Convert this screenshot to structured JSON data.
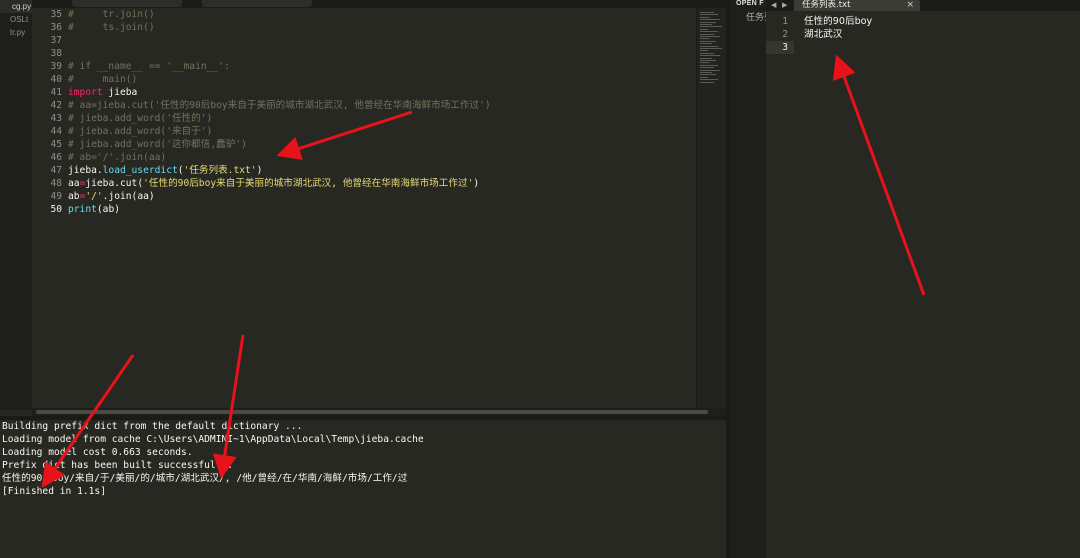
{
  "sidebar": {
    "items": [
      "cg.py",
      "OSLt",
      "tr.py"
    ]
  },
  "editor": {
    "active_line": 50,
    "lines": [
      {
        "n": 35,
        "segments": [
          {
            "t": "#     tr.join()",
            "c": "cm"
          }
        ]
      },
      {
        "n": 36,
        "segments": [
          {
            "t": "#     ts.join()",
            "c": "cm"
          }
        ]
      },
      {
        "n": 37,
        "segments": []
      },
      {
        "n": 38,
        "segments": []
      },
      {
        "n": 39,
        "segments": [
          {
            "t": "# if __name__ == '__main__':",
            "c": "cm"
          }
        ]
      },
      {
        "n": 40,
        "segments": [
          {
            "t": "#     main()",
            "c": "cm"
          }
        ]
      },
      {
        "n": 41,
        "segments": [
          {
            "t": "import",
            "c": "kw"
          },
          {
            "t": " jieba",
            "c": ""
          }
        ]
      },
      {
        "n": 42,
        "segments": [
          {
            "t": "# aa=jieba.cut('任性的90后boy来自于美丽的城市湖北武汉, 他曾经在华南海鲜市场工作过')",
            "c": "cm"
          }
        ]
      },
      {
        "n": 43,
        "segments": [
          {
            "t": "# jieba.add_word('任性的')",
            "c": "cm"
          }
        ]
      },
      {
        "n": 44,
        "segments": [
          {
            "t": "# jieba.add_word('来自于')",
            "c": "cm"
          }
        ]
      },
      {
        "n": 45,
        "segments": [
          {
            "t": "# jieba.add_word('这你都信,蠢驴')",
            "c": "cm"
          }
        ]
      },
      {
        "n": 46,
        "segments": [
          {
            "t": "# ab='/'.join(aa)",
            "c": "cm"
          }
        ]
      },
      {
        "n": 47,
        "segments": [
          {
            "t": "jieba.",
            "c": ""
          },
          {
            "t": "load_userdict",
            "c": "fn"
          },
          {
            "t": "(",
            "c": ""
          },
          {
            "t": "'任务列表.txt'",
            "c": "str"
          },
          {
            "t": ")",
            "c": ""
          }
        ]
      },
      {
        "n": 48,
        "segments": [
          {
            "t": "aa",
            "c": ""
          },
          {
            "t": "=",
            "c": "op"
          },
          {
            "t": "jieba.cut(",
            "c": ""
          },
          {
            "t": "'任性的90后boy来自于美丽的城市湖北武汉, 他曾经在华南海鲜市场工作过'",
            "c": "str"
          },
          {
            "t": ")",
            "c": ""
          }
        ]
      },
      {
        "n": 49,
        "segments": [
          {
            "t": "ab",
            "c": ""
          },
          {
            "t": "=",
            "c": "op"
          },
          {
            "t": "'/'",
            "c": "str"
          },
          {
            "t": ".join(aa)",
            "c": ""
          }
        ]
      },
      {
        "n": 50,
        "segments": [
          {
            "t": "print",
            "c": "fn"
          },
          {
            "t": "(ab)",
            "c": ""
          }
        ]
      }
    ]
  },
  "output": {
    "lines": [
      "Building prefix dict from the default dictionary ...",
      "Loading model from cache C:\\Users\\ADMINI~1\\AppData\\Local\\Temp\\jieba.cache",
      "Loading model cost 0.663 seconds.",
      "Prefix dict has been built successfully.",
      "任性的90后boy/来自/于/美丽/的/城市/湖北武汉/, /他/曾经/在/华南/海鲜/市场/工作/过",
      "[Finished in 1.1s]"
    ]
  },
  "right_pane": {
    "open_files_label": "OPEN FILES",
    "open_file_item": "任务列表.txt",
    "nav_prev": "◀",
    "nav_next": "▶",
    "tab_label": "任务列表.txt",
    "tab_close": "×",
    "active_line": 3,
    "lines": [
      {
        "n": 1,
        "text": "任性的90后boy"
      },
      {
        "n": 2,
        "text": "湖北武汉"
      },
      {
        "n": 3,
        "text": ""
      }
    ]
  },
  "colors": {
    "background": "#272822",
    "comment": "#75715e",
    "keyword": "#f92672",
    "function": "#66d9ef",
    "string": "#e6db74",
    "annotation_arrow": "#e8131a"
  }
}
